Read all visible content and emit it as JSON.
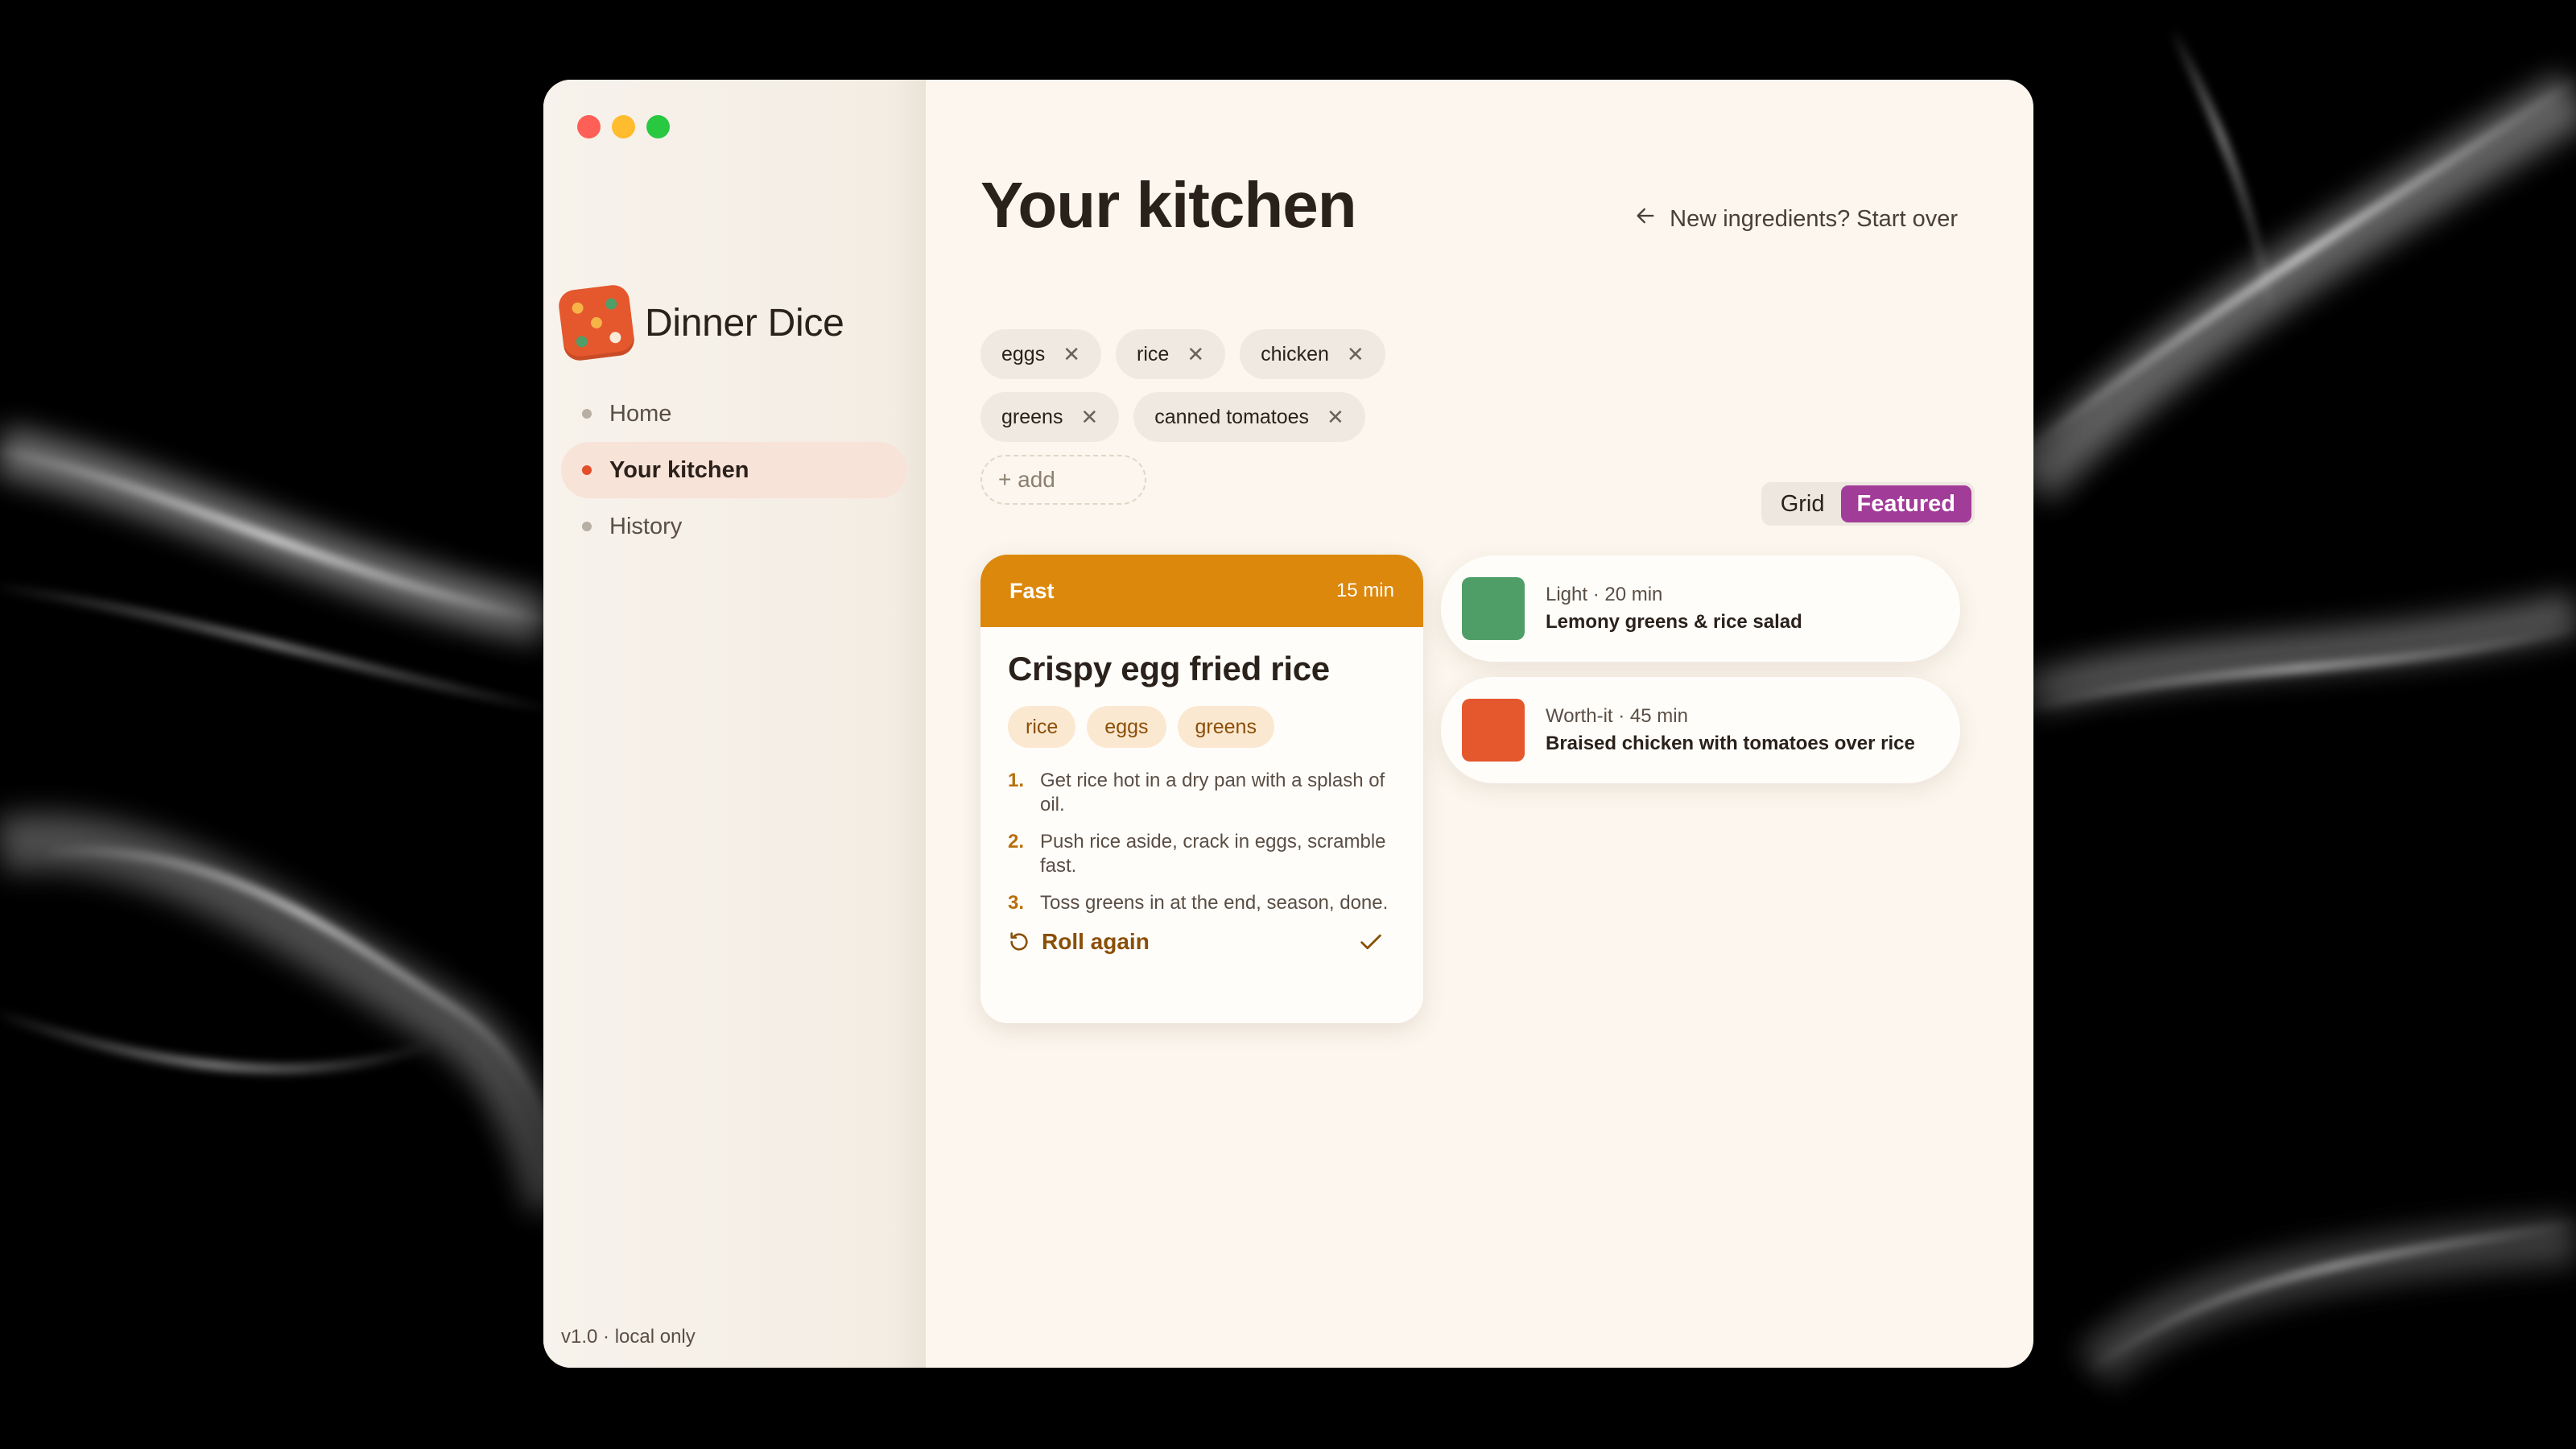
{
  "window": {
    "controls": [
      "close",
      "minimize",
      "zoom"
    ]
  },
  "sidebar": {
    "app_name": "Dinner Dice",
    "logo_icon": "dice-icon",
    "items": [
      {
        "label": "Home",
        "active": false
      },
      {
        "label": "Your kitchen",
        "active": true
      },
      {
        "label": "History",
        "active": false
      }
    ],
    "version": "v1.0 · local only"
  },
  "main": {
    "title": "Your kitchen",
    "start_over": "New ingredients? Start over",
    "ingredients": [
      "eggs",
      "rice",
      "chicken",
      "greens",
      "canned tomatoes"
    ],
    "add_label": "+ add",
    "remove_glyph": "✕",
    "view_toggle": {
      "options": [
        "Grid",
        "Featured"
      ],
      "selected": "Featured"
    },
    "featured": {
      "tag": "Fast",
      "time": "15 min",
      "title": "Crispy egg fried rice",
      "ingredients": [
        "rice",
        "eggs",
        "greens"
      ],
      "steps": [
        {
          "num": "1.",
          "text": "Get rice hot in a dry pan with a splash of oil."
        },
        {
          "num": "2.",
          "text": "Push rice aside, crack in eggs, scramble fast."
        },
        {
          "num": "3.",
          "text": "Toss greens in at the end, season, done."
        }
      ],
      "roll_again": "Roll again",
      "header_color": "#dc880d"
    },
    "alternatives": [
      {
        "meta": "Light · 20 min",
        "name": "Lemony greens & rice salad",
        "color": "#4f9e67"
      },
      {
        "meta": "Worth-it · 45 min",
        "name": "Braised chicken with tomatoes over rice",
        "color": "#e5572d"
      }
    ]
  },
  "colors": {
    "accent": "#e34d2a",
    "toggle_active": "#a13c98",
    "amber": "#dc880d"
  }
}
